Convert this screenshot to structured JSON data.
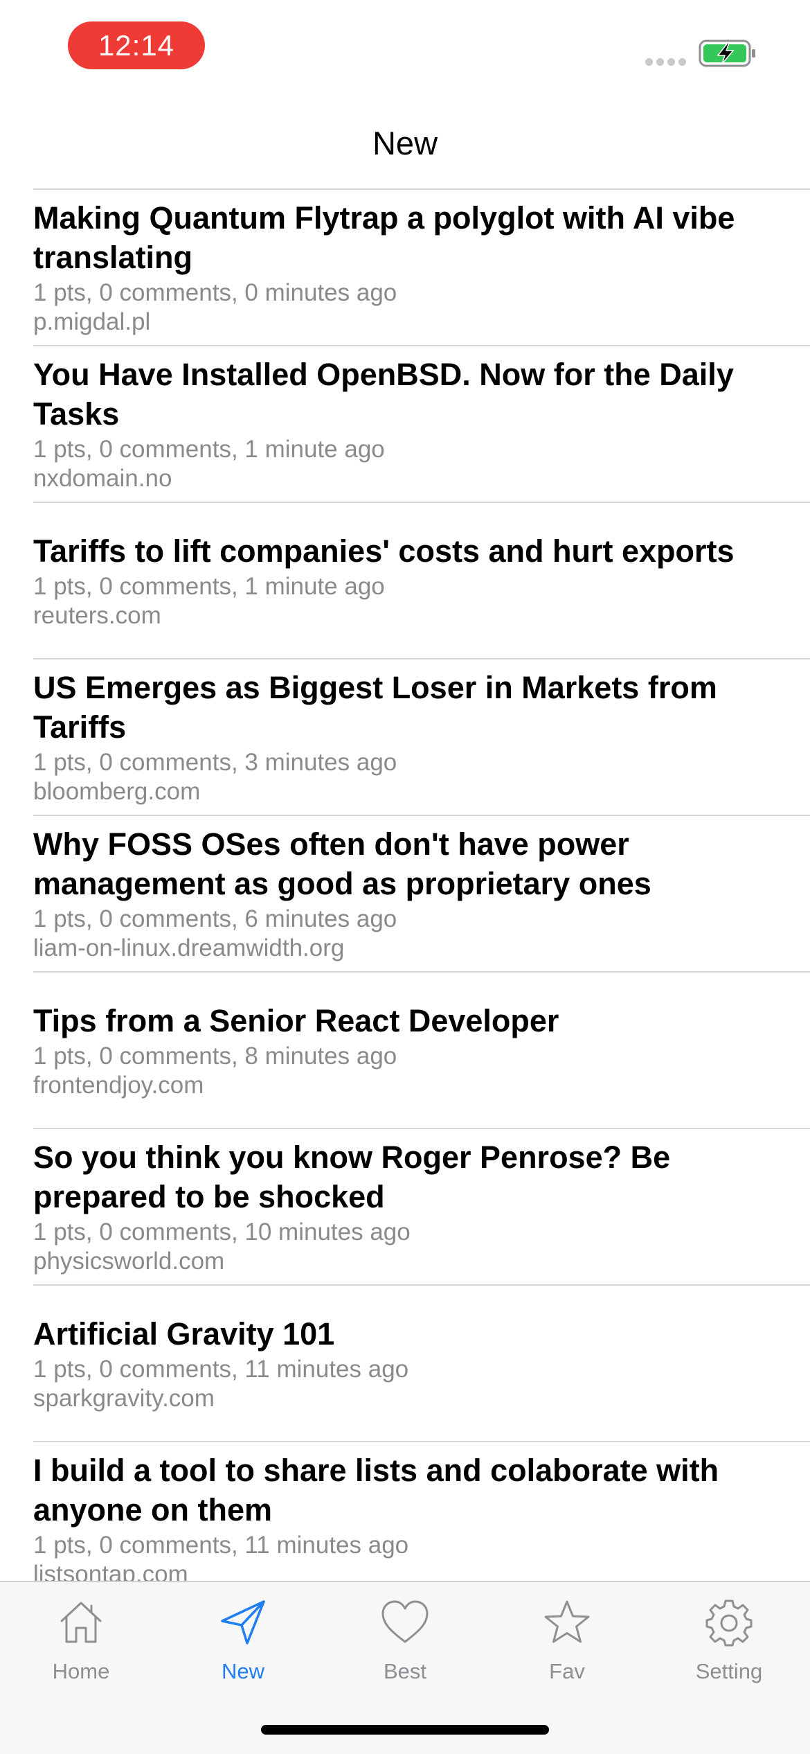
{
  "status_bar": {
    "time": "12:14",
    "battery_state": "charging",
    "battery_color": "#35c759",
    "time_pill_color": "#ef3b35"
  },
  "header": {
    "title": "New"
  },
  "stories": [
    {
      "title": "Making Quantum Flytrap a polyglot with AI vibe translating",
      "meta": "1 pts, 0 comments, 0 minutes ago",
      "domain": "p.migdal.pl"
    },
    {
      "title": "You Have Installed OpenBSD. Now for the Daily Tasks",
      "meta": "1 pts, 0 comments, 1 minute ago",
      "domain": "nxdomain.no"
    },
    {
      "title": "Tariffs to lift companies' costs and hurt exports",
      "meta": "1 pts, 0 comments, 1 minute ago",
      "domain": "reuters.com"
    },
    {
      "title": "US Emerges as Biggest Loser in Markets from Tariffs",
      "meta": "1 pts, 0 comments, 3 minutes ago",
      "domain": "bloomberg.com"
    },
    {
      "title": "Why FOSS OSes often don't have power management as good as proprietary ones",
      "meta": "1 pts, 0 comments, 6 minutes ago",
      "domain": "liam-on-linux.dreamwidth.org"
    },
    {
      "title": "Tips from a Senior React Developer",
      "meta": "1 pts, 0 comments, 8 minutes ago",
      "domain": "frontendjoy.com"
    },
    {
      "title": "So you think you know Roger Penrose? Be prepared to be shocked",
      "meta": "1 pts, 0 comments, 10 minutes ago",
      "domain": "physicsworld.com"
    },
    {
      "title": "Artificial Gravity 101",
      "meta": "1 pts, 0 comments, 11 minutes ago",
      "domain": "sparkgravity.com"
    },
    {
      "title": "I build a tool to share lists and colaborate with anyone on them",
      "meta": "1 pts, 0 comments, 11 minutes ago",
      "domain": "listsontap.com"
    }
  ],
  "tab_bar": {
    "active_color": "#1f7ef2",
    "inactive_color": "#8e8e93",
    "tabs": [
      {
        "label": "Home",
        "icon": "house-icon",
        "active": false
      },
      {
        "label": "New",
        "icon": "paper-plane-icon",
        "active": true
      },
      {
        "label": "Best",
        "icon": "heart-icon",
        "active": false
      },
      {
        "label": "Fav",
        "icon": "star-icon",
        "active": false
      },
      {
        "label": "Setting",
        "icon": "gear-icon",
        "active": false
      }
    ]
  }
}
